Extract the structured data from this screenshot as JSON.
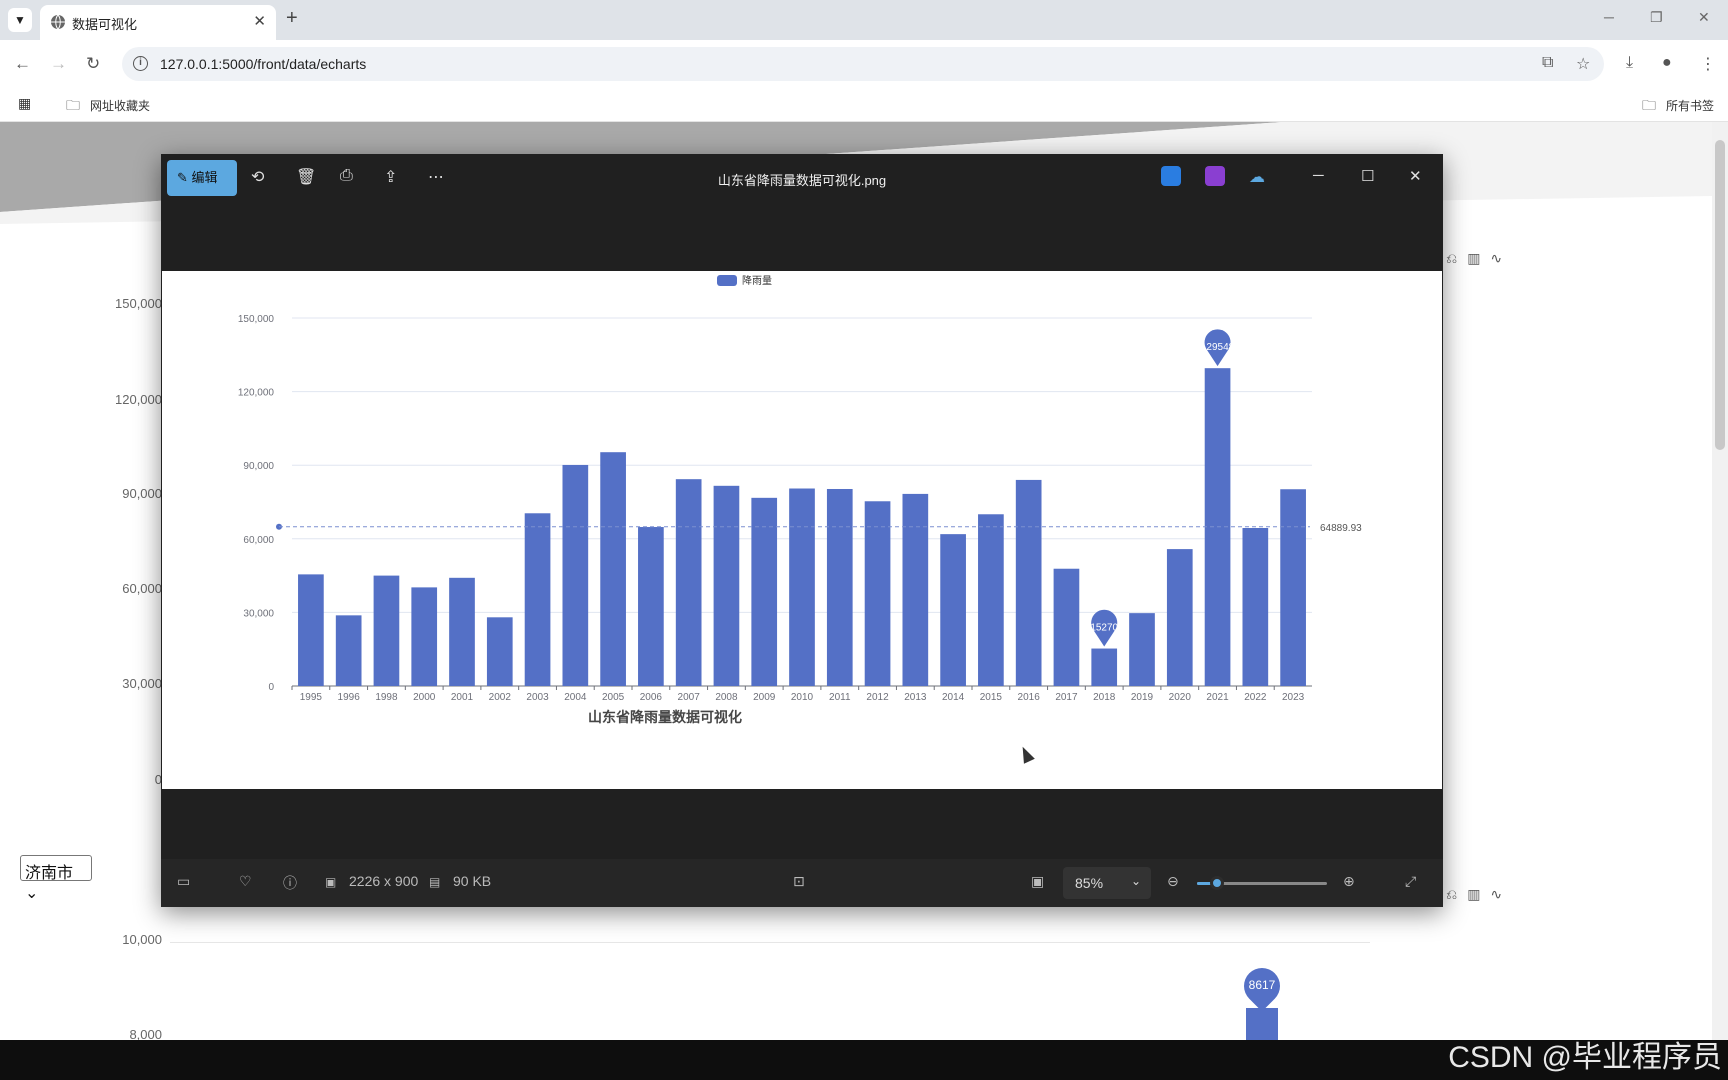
{
  "browser": {
    "tab_title": "数据可视化",
    "url": "127.0.0.1:5000/front/data/echarts",
    "bookmarks_folder": "网址收藏夹",
    "all_bookmarks": "所有书签"
  },
  "page": {
    "bg_axis_labels": [
      "150,000",
      "120,000",
      "90,000",
      "60,000",
      "30,000",
      "0"
    ],
    "city_select": "济南市",
    "bg_chart2_ytick": "10,000",
    "bg_chart2_ytick2": "8,000",
    "bg_chart2_pin": "8617"
  },
  "viewer": {
    "edit_label": "编辑",
    "filename": "山东省降雨量数据可视化.png",
    "dimensions": "2226 x 900",
    "filesize": "90 KB",
    "zoom": "85%",
    "zoom_fraction": 0.15
  },
  "chart_data": {
    "type": "bar",
    "title": "山东省降雨量数据可视化",
    "legend": "降雨量",
    "categories": [
      "1995",
      "1996",
      "1998",
      "2000",
      "2001",
      "2002",
      "2003",
      "2004",
      "2005",
      "2006",
      "2007",
      "2008",
      "2009",
      "2010",
      "2011",
      "2012",
      "2013",
      "2014",
      "2015",
      "2016",
      "2017",
      "2018",
      "2019",
      "2020",
      "2021",
      "2022",
      "2023"
    ],
    "series": [
      {
        "name": "降雨量",
        "values": [
          45500,
          28800,
          45000,
          40200,
          44100,
          28000,
          70400,
          90100,
          95300,
          64800,
          84300,
          81600,
          76700,
          80500,
          80300,
          75300,
          78300,
          61900,
          70000,
          84000,
          47800,
          15270,
          29700,
          55800,
          129548,
          64400,
          80200
        ]
      }
    ],
    "ylim": [
      0,
      150000
    ],
    "yticks": [
      "150,000",
      "120,000",
      "90,000",
      "60,000",
      "30,000",
      "0"
    ],
    "mark_point_max": "129548",
    "mark_point_min": "15270",
    "mark_line_average": "64889.93",
    "average_value": 64889.93,
    "grid": true,
    "legend_position": "top-center",
    "bar_color": "#5470c6"
  },
  "watermark": "CSDN @毕业程序员"
}
